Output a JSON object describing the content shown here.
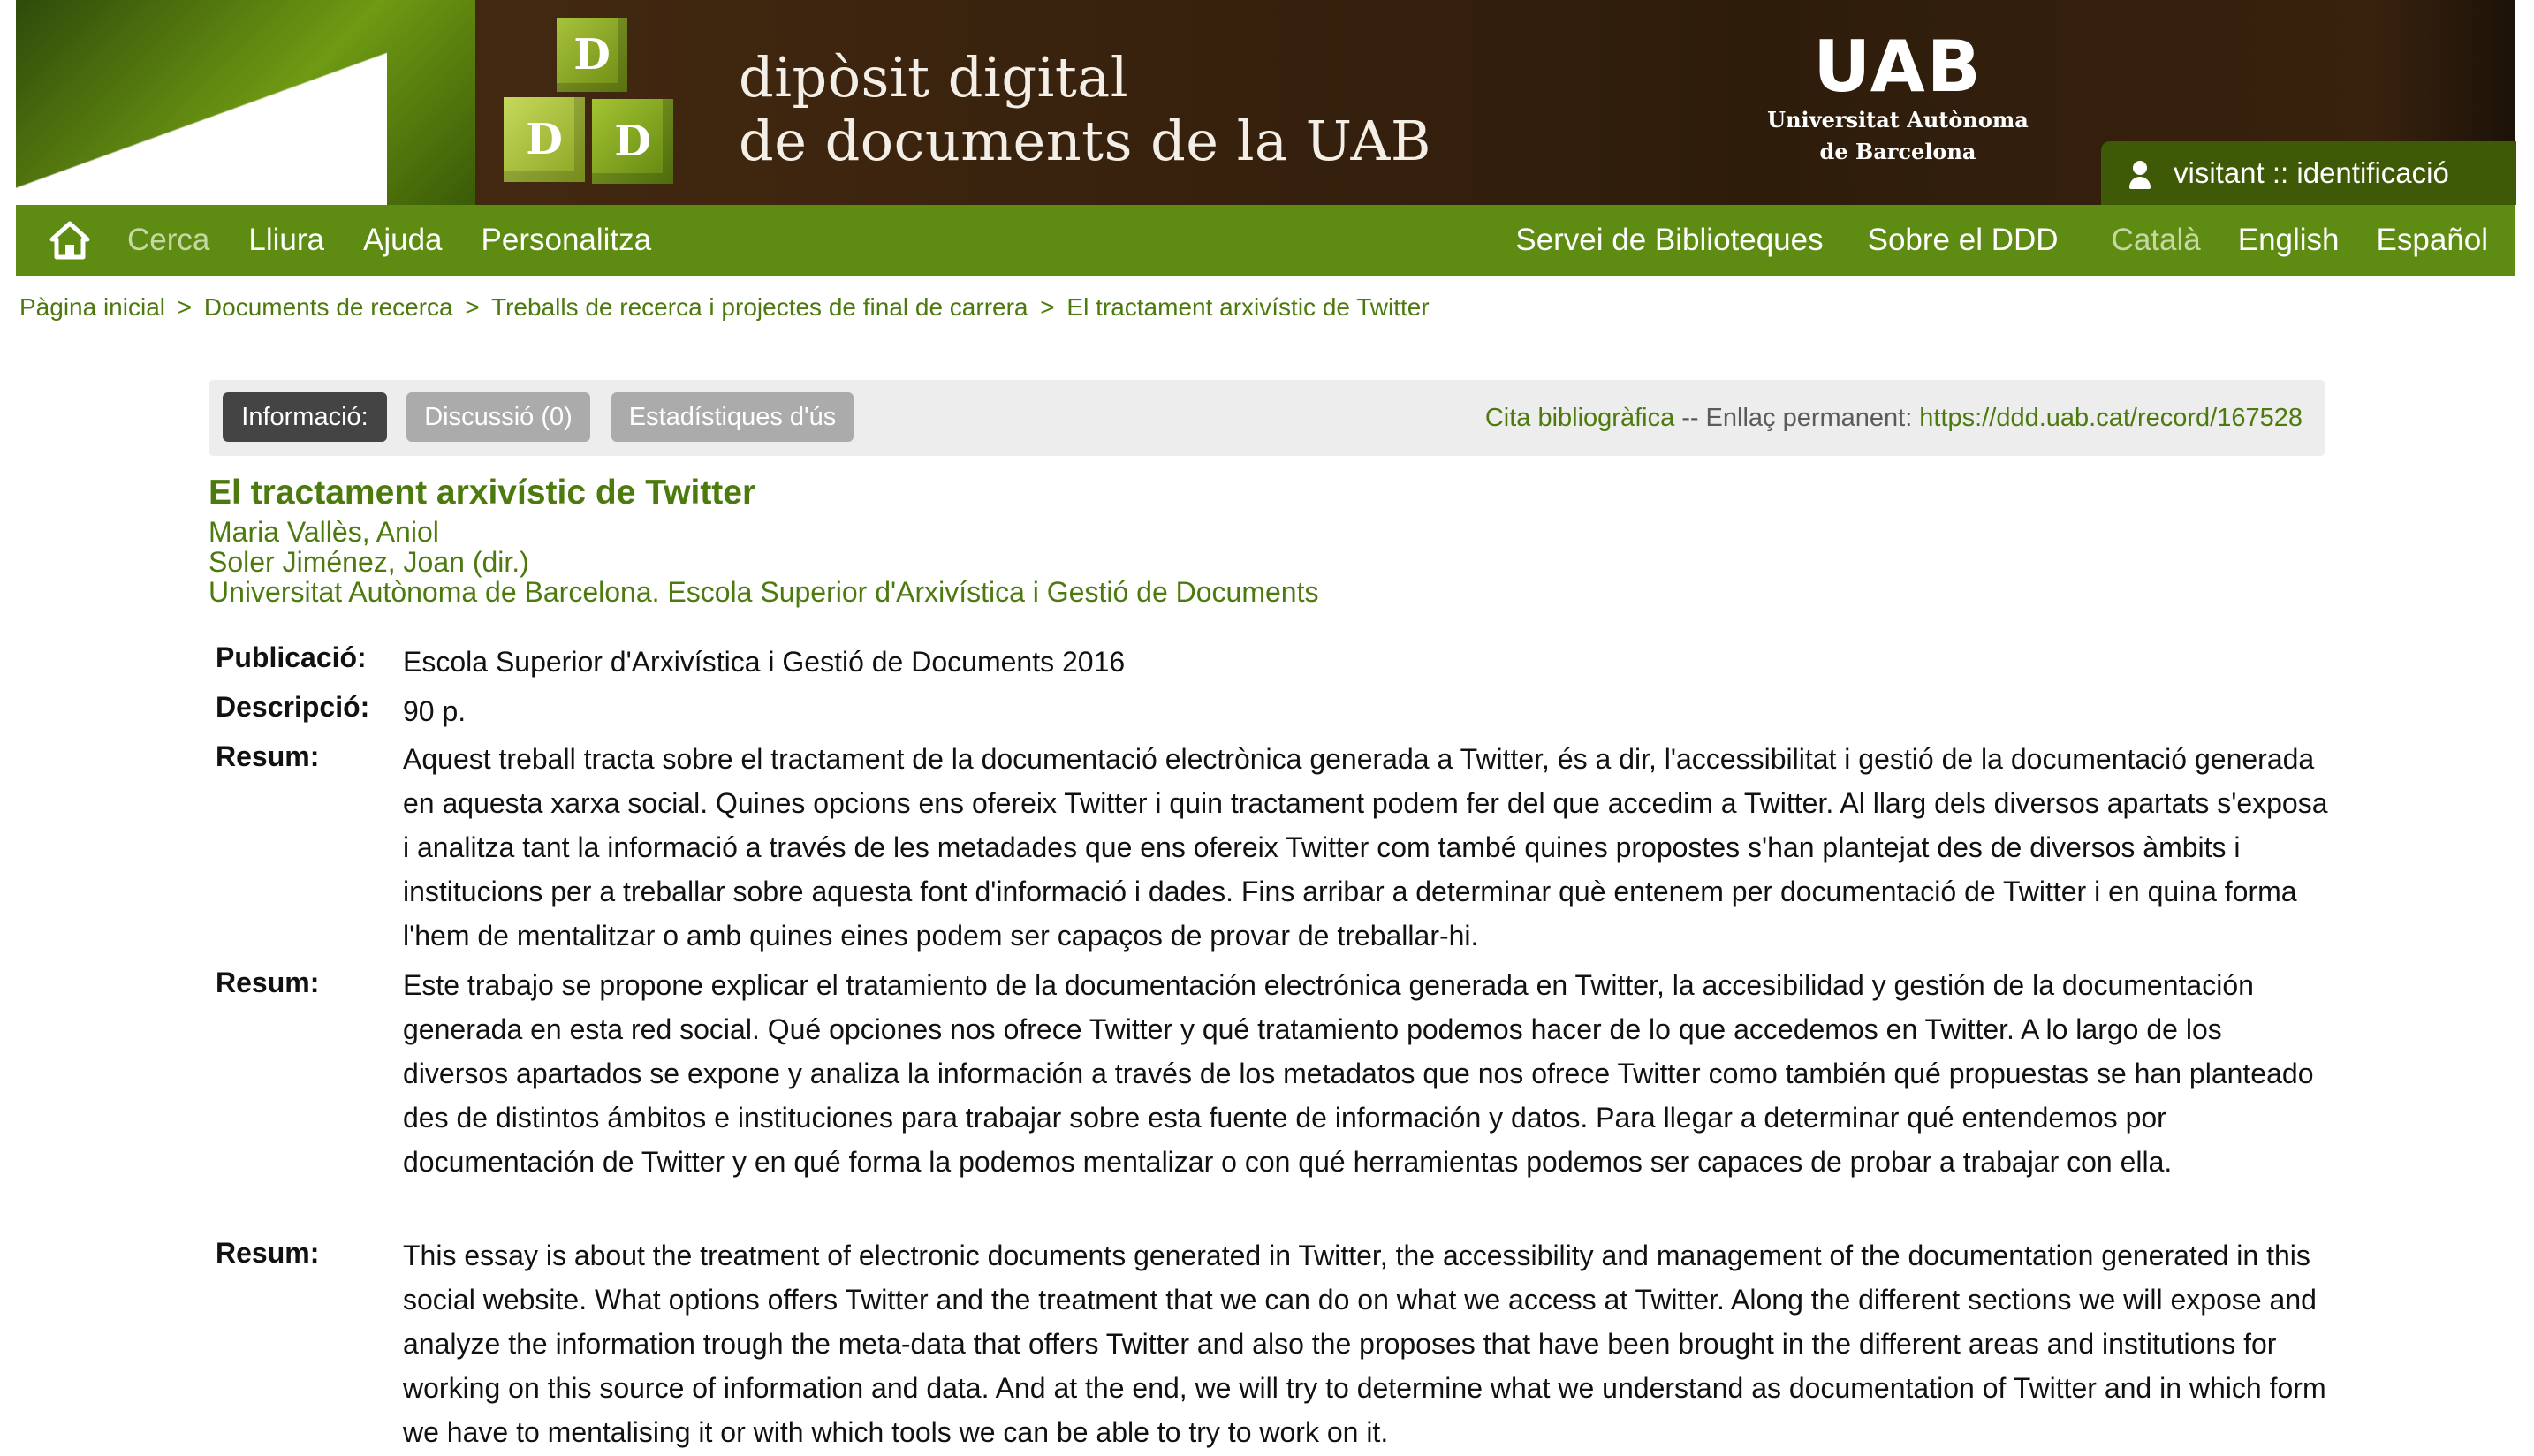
{
  "header": {
    "title_line1": "dipòsit digital",
    "title_line2": "de documents de la UAB",
    "logo_cubes": [
      "D",
      "D",
      "D"
    ],
    "uab_mark": "UAB",
    "uab_sub1": "Universitat Autònoma",
    "uab_sub2": "de Barcelona",
    "login_text": "visitant :: identificació"
  },
  "nav": {
    "home_icon": "home-icon",
    "items": [
      "Cerca",
      "Lliura",
      "Ajuda",
      "Personalitza"
    ],
    "right_items": [
      "Servei de Biblioteques",
      "Sobre el DDD"
    ],
    "languages": [
      "Català",
      "English",
      "Español"
    ]
  },
  "breadcrumb": [
    "Pàgina inicial",
    "Documents de recerca",
    "Treballs de recerca i projectes de final de carrera",
    "El tractament arxivístic de Twitter"
  ],
  "breadcrumb_sep": ">",
  "tabs": {
    "info": "Informació:",
    "discussion": "Discussió (0)",
    "stats": "Estadístiques d'ús"
  },
  "citation": {
    "cite_label": "Cita bibliogràfica",
    "dash": "--",
    "permalink_label": "Enllaç permanent:",
    "permalink_url": "https://ddd.uab.cat/record/167528"
  },
  "record": {
    "title": "El tractament arxivístic de Twitter",
    "author": "Maria Vallès, Aniol",
    "director": "Soler Jiménez, Joan (dir.)",
    "institution": "Universitat Autònoma de Barcelona. Escola Superior d'Arxivística i Gestió de Documents"
  },
  "metadata": {
    "publication_label": "Publicació:",
    "publication_value": "Escola Superior d'Arxivística i Gestió de Documents 2016",
    "description_label": "Descripció:",
    "description_value": "90 p.",
    "abstract_label": "Resum:",
    "abstract_ca": "Aquest treball tracta sobre el tractament de la documentació electrònica generada a Twitter, és a dir, l'accessibilitat i gestió de la documentació generada en aquesta xarxa social. Quines opcions ens ofereix Twitter i quin tractament podem fer del que accedim a Twitter. Al llarg dels diversos apartats s'exposa i analitza tant la informació a través de les metadades que ens ofereix Twitter com també quines propostes s'han plantejat des de diversos àmbits i institucions per a treballar sobre aquesta font d'informació i dades. Fins arribar a determinar què entenem per documentació de Twitter i en quina forma l'hem de mentalitzar o amb quines eines podem ser capaços de provar de treballar-hi.",
    "abstract_es": "Este trabajo se propone explicar el tratamiento de la documentación electrónica generada en Twitter, la accesibilidad y gestión de la documentación generada en esta red social. Qué opciones nos ofrece Twitter y qué tratamiento podemos hacer de lo que accedemos en Twitter. A lo largo de los diversos apartados se expone y analiza la información a través de los metadatos que nos ofrece Twitter como también qué propuestas se han planteado des de distintos ámbitos e instituciones para trabajar sobre esta fuente de información y datos. Para llegar a determinar qué entendemos por documentación de Twitter y en qué forma la podemos mentalizar o con qué herramientas podemos ser capaces de probar a trabajar con ella.",
    "abstract_en": "This essay is about the treatment of electronic documents generated in Twitter, the accessibility and management of the documentation generated in this social website. What options offers Twitter and the treatment that we can do on what we access at Twitter. Along the different sections we will expose and analyze the information trough the meta-data that offers Twitter and also the proposes that have been brought in the different areas and institutions for working on this source of information and data. And at the end, we will try to determine what we understand as documentation of Twitter and in which form we have to mentalising it or with which tools we can be able to try to work on it."
  },
  "colors": {
    "accent_green": "#5e8b12",
    "link_green": "#4d7a0e",
    "banner_brown": "#3a230e"
  }
}
